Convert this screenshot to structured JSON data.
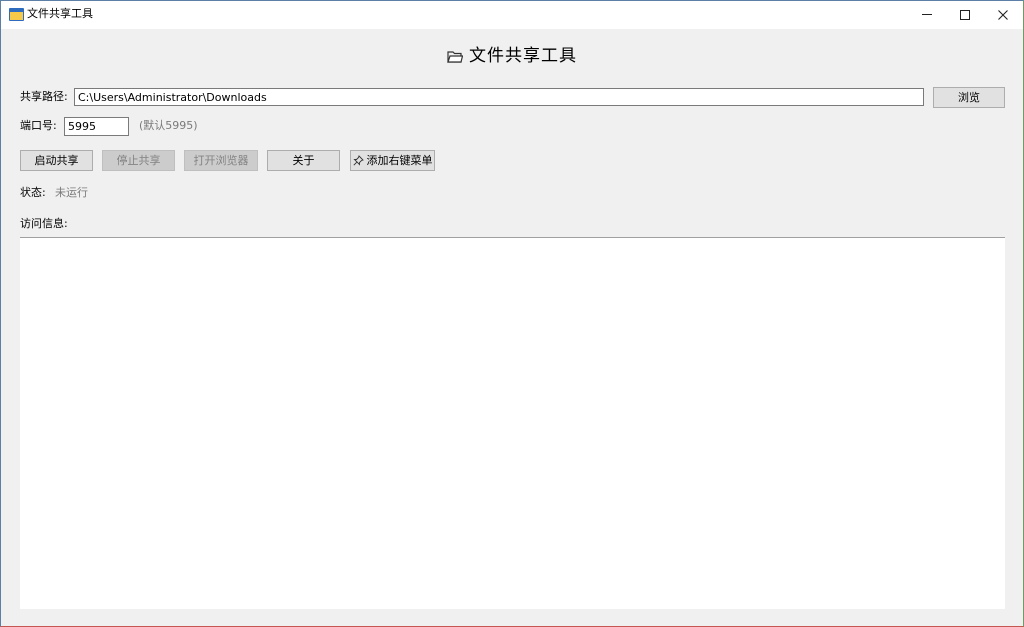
{
  "window": {
    "title": "文件共享工具",
    "icon": "app-window-icon"
  },
  "heading": {
    "icon": "folder-icon",
    "text": "文件共享工具"
  },
  "form": {
    "path_label": "共享路径:",
    "path_value": "C:\\Users\\Administrator\\Downloads",
    "browse_label": "浏览",
    "port_label": "端口号:",
    "port_value": "5995",
    "port_hint": "(默认5995)"
  },
  "actions": {
    "start_label": "启动共享",
    "stop_label": "停止共享",
    "open_browser_label": "打开浏览器",
    "about_label": "关于",
    "context_menu_label": "添加右键菜单"
  },
  "status": {
    "label": "状态:",
    "value": "未运行"
  },
  "access": {
    "label": "访问信息:",
    "content": ""
  }
}
